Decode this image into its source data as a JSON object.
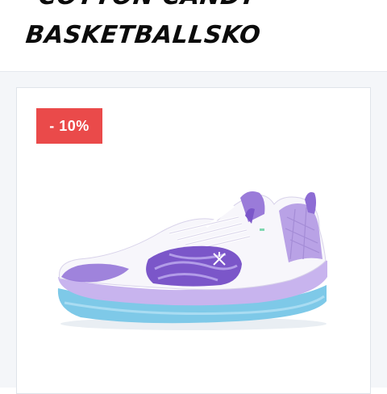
{
  "header": {
    "title_line_1": "\"COTTON CANDY\"",
    "title_line_2": "BASKETBALLSKO"
  },
  "product": {
    "discount_badge": "- 10%",
    "image_icon": "basketball-shoe-image"
  },
  "colors": {
    "badge": "#ea4a4a",
    "page_background": "#f4f6f9",
    "shoe_lilac": "#b9a2e6",
    "shoe_purple": "#7b56c9",
    "shoe_sole_blue": "#7ec9e8",
    "shoe_white": "#f7f6fb"
  }
}
